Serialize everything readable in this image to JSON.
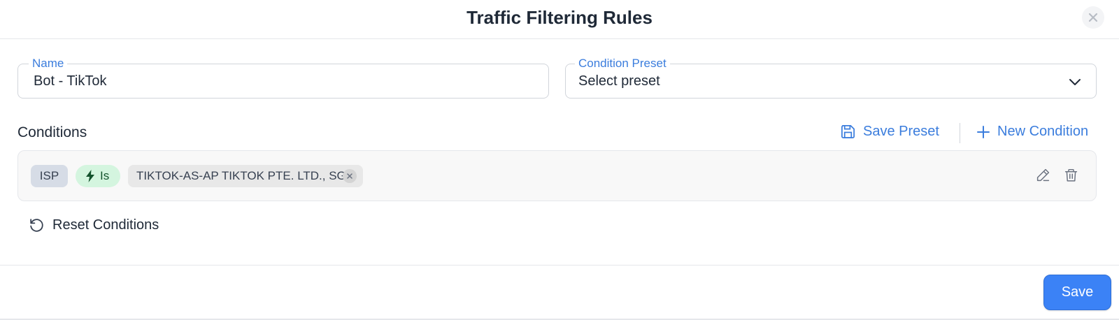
{
  "modal": {
    "title": "Traffic Filtering Rules",
    "close_icon": "close-icon"
  },
  "form": {
    "name": {
      "label": "Name",
      "value": "Bot - TikTok"
    },
    "preset": {
      "label": "Condition Preset",
      "value": "Select preset",
      "icon": "chevron-down-icon"
    }
  },
  "conditions": {
    "title": "Conditions",
    "save_preset_label": "Save Preset",
    "save_preset_icon": "save-icon",
    "new_condition_label": "New Condition",
    "new_condition_icon": "plus-icon",
    "items": [
      {
        "field": "ISP",
        "operator": "Is",
        "operator_icon": "lightning-icon",
        "value": "TIKTOK-AS-AP TIKTOK PTE. LTD., SG"
      }
    ],
    "reset_label": "Reset Conditions",
    "reset_icon": "reset-icon"
  },
  "footer": {
    "save_label": "Save"
  },
  "colors": {
    "accent": "#3b7ddd",
    "primary_button": "#3b82f6",
    "operator_chip": "#d4f5df",
    "field_chip": "#d6dce6"
  }
}
